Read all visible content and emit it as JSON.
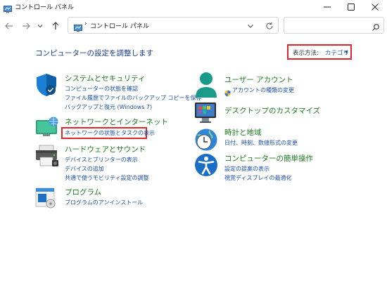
{
  "window": {
    "title": "コントロール パネル"
  },
  "address": {
    "crumb": "コントロール パネル",
    "sep": "›"
  },
  "search": {
    "placeholder": ""
  },
  "header": {
    "title": "コンピューターの設定を調整します",
    "view_by_label": "表示方法:",
    "view_by_value": "カテゴリ"
  },
  "categories": {
    "system": {
      "title": "システムとセキュリティ",
      "links": [
        "コンピューターの状態を確認",
        "ファイル履歴でファイルのバックアップ コピーを保存",
        "バックアップと復元 (Windows 7)"
      ]
    },
    "network": {
      "title": "ネットワークとインターネット",
      "links": [
        "ネットワークの状態とタスクの表示"
      ]
    },
    "hardware": {
      "title": "ハードウェアとサウンド",
      "links": [
        "デバイスとプリンターの表示",
        "デバイスの追加",
        "共通で使うモビリティ設定の調整"
      ]
    },
    "programs": {
      "title": "プログラム",
      "links": [
        "プログラムのアンインストール"
      ]
    },
    "users": {
      "title": "ユーザー アカウント",
      "links": [
        "アカウントの種類の変更"
      ]
    },
    "appearance": {
      "title": "デスクトップのカスタマイズ",
      "links": []
    },
    "clock": {
      "title": "時計と地域",
      "links": [
        "日付、時刻、数値形式の変更"
      ]
    },
    "ease": {
      "title": "コンピューターの簡単操作",
      "links": [
        "設定の提案の表示",
        "視覚ディスプレイの最適化"
      ]
    }
  },
  "icons": {
    "title_icon": "control-panel-icon",
    "back": "arrow-left-icon",
    "forward": "arrow-right-icon",
    "recent": "chevron-down-icon",
    "up": "arrow-up-icon",
    "refresh": "refresh-icon",
    "search": "search-icon",
    "minimize": "minimize-icon",
    "maximize": "maximize-icon",
    "close": "close-icon"
  },
  "colors": {
    "category_title": "#1e7b1e",
    "link": "#1a4fa8",
    "heading": "#1a3e8c",
    "highlight": "#e0262b"
  }
}
